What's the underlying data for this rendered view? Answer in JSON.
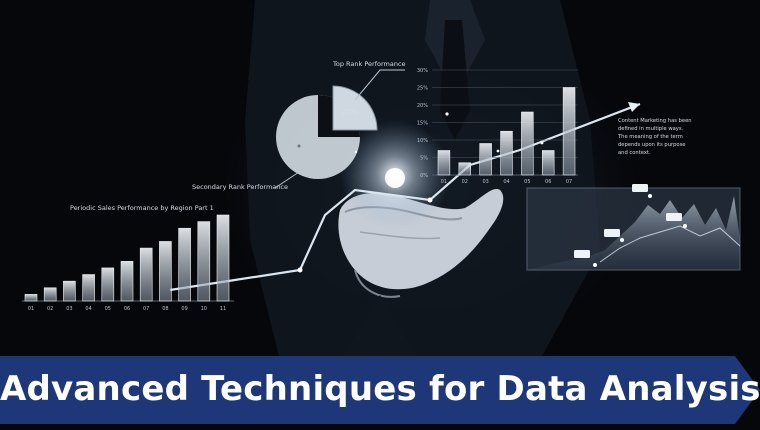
{
  "banner": {
    "title": "Advanced Techniques for Data Analysis",
    "color": "#1d3778"
  },
  "labels": {
    "top_rank": "Top Rank Performance",
    "secondary_rank": "Secondary Rank Performance",
    "periodic_sales": "Periodic Sales Performance by Region Part 1",
    "pie_percent": "25%",
    "content_note": [
      "Content Marketing has been",
      "defined in multiple ways.",
      "The meaning of the term",
      "depends upon its purpose",
      "and context."
    ]
  },
  "chart_data": [
    {
      "type": "bar",
      "title": "Periodic Sales Performance by Region Part 1",
      "categories": [
        "01",
        "02",
        "03",
        "04",
        "05",
        "06",
        "07",
        "08",
        "09",
        "10",
        "11"
      ],
      "values": [
        1,
        2,
        3,
        4,
        5,
        6,
        8,
        9,
        11,
        12,
        13
      ]
    },
    {
      "type": "bar",
      "title": "Top Rank Performance",
      "categories": [
        "01",
        "02",
        "03",
        "04",
        "05",
        "06",
        "07"
      ],
      "values": [
        7,
        3.5,
        9,
        12.5,
        18,
        7,
        25
      ],
      "yticks": [
        "30%",
        "25%",
        "20%",
        "15%",
        "10%",
        "5%",
        "0%"
      ],
      "ylim": [
        0,
        30
      ]
    },
    {
      "type": "pie",
      "values": [
        25,
        75
      ],
      "labels": [
        "25%",
        ""
      ]
    }
  ]
}
